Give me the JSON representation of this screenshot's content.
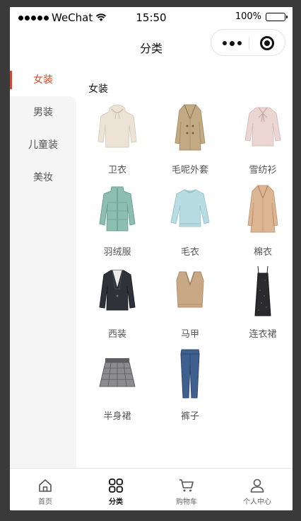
{
  "status_bar": {
    "carrier": "WeChat",
    "time": "15:50",
    "battery": "100%"
  },
  "nav": {
    "title": "分类"
  },
  "sidebar": {
    "items": [
      {
        "label": "女装",
        "active": true
      },
      {
        "label": "男装",
        "active": false
      },
      {
        "label": "儿童装",
        "active": false
      },
      {
        "label": "美妆",
        "active": false
      }
    ]
  },
  "content": {
    "section_title": "女装",
    "products": [
      {
        "label": "卫衣",
        "icon": "hoodie-icon"
      },
      {
        "label": "毛呢外套",
        "icon": "wool-coat-icon"
      },
      {
        "label": "雪纺衫",
        "icon": "chiffon-blouse-icon"
      },
      {
        "label": "羽绒服",
        "icon": "down-jacket-icon"
      },
      {
        "label": "毛衣",
        "icon": "sweater-icon"
      },
      {
        "label": "棉衣",
        "icon": "cotton-coat-icon"
      },
      {
        "label": "西装",
        "icon": "blazer-icon"
      },
      {
        "label": "马甲",
        "icon": "vest-icon"
      },
      {
        "label": "连衣裙",
        "icon": "dress-icon"
      },
      {
        "label": "半身裙",
        "icon": "skirt-icon"
      },
      {
        "label": "裤子",
        "icon": "jeans-icon"
      }
    ]
  },
  "tabbar": {
    "items": [
      {
        "label": "首页",
        "icon": "home-icon",
        "active": false
      },
      {
        "label": "分类",
        "icon": "category-grid-icon",
        "active": true
      },
      {
        "label": "购物车",
        "icon": "cart-icon",
        "active": false
      },
      {
        "label": "个人中心",
        "icon": "user-icon",
        "active": false
      }
    ]
  },
  "colors": {
    "accent": "#d9472b",
    "sidebar_bg": "#f5f5f5"
  }
}
